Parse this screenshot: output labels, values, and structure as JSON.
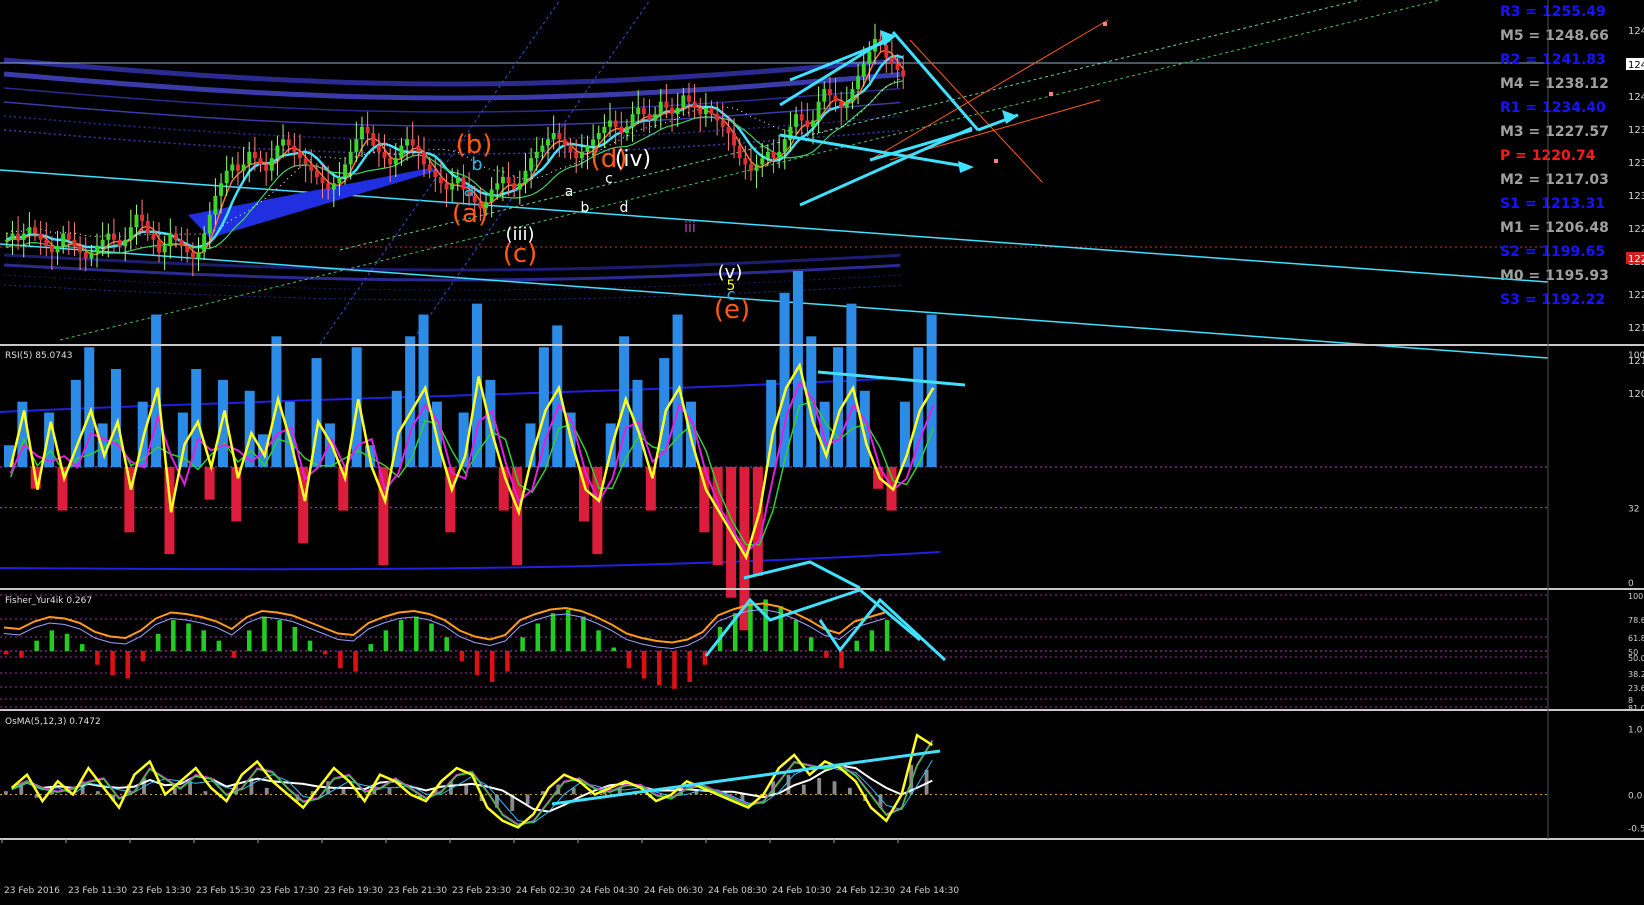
{
  "colors": {
    "background": "#000000",
    "separator": "#c8c8c8",
    "axis_text": "#d0d0d0",
    "cyan": "#40e0ff",
    "candle_up": "#3fd62a",
    "candle_down": "#e03030",
    "pivot_blue": "#1414ff",
    "pivot_gray": "#a0a0a0",
    "pivot_red": "#ff1a1a",
    "rsi_line": "#ffff20",
    "hist_pos": "#2b8be6",
    "hist_neg": "#dc1e3c",
    "fisher_pos": "#22cc22",
    "fisher_neg": "#dd1111",
    "fisher_line": "#ff9a1a",
    "wave_orange": "#ff5a14",
    "wave_white": "#ffffff",
    "wave_cyan": "#30b0e0"
  },
  "pivots": [
    {
      "label": "R3 = 1255.49",
      "color": "#1414ff"
    },
    {
      "label": "M5 = 1248.66",
      "color": "#a0a0a0"
    },
    {
      "label": "R2 = 1241.83",
      "color": "#1414ff"
    },
    {
      "label": "M4 = 1238.12",
      "color": "#a0a0a0"
    },
    {
      "label": "R1 = 1234.40",
      "color": "#1414ff"
    },
    {
      "label": "M3 = 1227.57",
      "color": "#a0a0a0"
    },
    {
      "label": "P  = 1220.74",
      "color": "#ff1a1a"
    },
    {
      "label": "M2 = 1217.03",
      "color": "#a0a0a0"
    },
    {
      "label": "S1 = 1213.31",
      "color": "#1414ff"
    },
    {
      "label": "M1 = 1206.48",
      "color": "#a0a0a0"
    },
    {
      "label": "S2 = 1199.65",
      "color": "#1414ff"
    },
    {
      "label": "M0 = 1195.93",
      "color": "#a0a0a0"
    },
    {
      "label": "S3 = 1192.22",
      "color": "#1414ff"
    }
  ],
  "wave_labels": [
    {
      "text": "(b)",
      "color": "#ff5a14"
    },
    {
      "text": "b",
      "color": "#30b0e0"
    },
    {
      "text": "a",
      "color": "#30b0e0"
    },
    {
      "text": "(a)",
      "color": "#ff5a14"
    },
    {
      "text": "(iii)",
      "color": "#ffffff"
    },
    {
      "text": "(c)",
      "color": "#ff5a14"
    },
    {
      "text": "(d)",
      "color": "#ff5a14"
    },
    {
      "text": "(iv)",
      "color": "#ffffff"
    },
    {
      "text": "a",
      "color": "#ffffff"
    },
    {
      "text": "b",
      "color": "#ffffff"
    },
    {
      "text": "c",
      "color": "#ffffff"
    },
    {
      "text": "d",
      "color": "#ffffff"
    },
    {
      "text": "iii",
      "color": "#c040c0"
    },
    {
      "text": "(v)",
      "color": "#ffffff"
    },
    {
      "text": "5",
      "color": "#ffff20"
    },
    {
      "text": "c",
      "color": "#30b0e0"
    },
    {
      "text": "(e)",
      "color": "#ff5a14"
    }
  ],
  "time_labels": [
    "23 Feb 2016",
    "23 Feb 11:30",
    "23 Feb 13:30",
    "23 Feb 15:30",
    "23 Feb 17:30",
    "23 Feb 19:30",
    "23 Feb 21:30",
    "23 Feb 23:30",
    "24 Feb 02:30",
    "24 Feb 04:30",
    "24 Feb 06:30",
    "24 Feb 08:30",
    "24 Feb 10:30",
    "24 Feb 12:30",
    "24 Feb 14:30"
  ],
  "chart_data": [
    {
      "type": "candlestick",
      "panel": "price",
      "y_tick_labels": [
        "124",
        "124",
        "124",
        "123",
        "123",
        "123",
        "122",
        "122",
        "122",
        "121",
        "121",
        "120"
      ],
      "price_marker_top": "124",
      "price_marker_mid": "122",
      "close": [
        1215,
        1216,
        1215,
        1216,
        1217,
        1216,
        1215,
        1214,
        1213,
        1214,
        1216,
        1215,
        1214,
        1213,
        1212,
        1213,
        1214,
        1215,
        1216,
        1215,
        1214,
        1215,
        1217,
        1219,
        1218,
        1216,
        1215,
        1213,
        1214,
        1216,
        1215,
        1214,
        1213,
        1212,
        1213,
        1216,
        1219,
        1222,
        1224,
        1226,
        1227,
        1226,
        1227,
        1229,
        1228,
        1227,
        1226,
        1228,
        1230,
        1231,
        1230,
        1229,
        1228,
        1227,
        1226,
        1225,
        1224,
        1223,
        1224,
        1225,
        1227,
        1229,
        1231,
        1233,
        1232,
        1230,
        1229,
        1228,
        1227,
        1228,
        1230,
        1231,
        1230,
        1229,
        1227,
        1226,
        1225,
        1224,
        1223,
        1224,
        1225,
        1223,
        1222,
        1221,
        1220,
        1221,
        1223,
        1224,
        1225,
        1224,
        1223,
        1224,
        1226,
        1228,
        1229,
        1230,
        1231,
        1232,
        1231,
        1230,
        1229,
        1228,
        1229,
        1230,
        1231,
        1232,
        1233,
        1234,
        1233,
        1232,
        1233,
        1235,
        1236,
        1235,
        1234,
        1235,
        1237,
        1236,
        1235,
        1236,
        1238,
        1237,
        1236,
        1235,
        1236,
        1235,
        1234,
        1233,
        1232,
        1230,
        1228,
        1227,
        1226,
        1227,
        1228,
        1229,
        1228,
        1229,
        1231,
        1233,
        1235,
        1234,
        1233,
        1234,
        1237,
        1239,
        1238,
        1237,
        1236,
        1237,
        1239,
        1241,
        1243,
        1245,
        1247,
        1246,
        1244,
        1243,
        1242,
        1241
      ]
    },
    {
      "type": "bar",
      "panel": "rsi",
      "title": "RSI(5) 85.0743",
      "y_tick_labels": [
        "100",
        "32",
        "0"
      ],
      "ylim": [
        0,
        100
      ],
      "rsi": [
        50,
        75,
        40,
        70,
        45,
        60,
        75,
        55,
        70,
        40,
        65,
        85,
        30,
        60,
        70,
        50,
        75,
        45,
        65,
        55,
        80,
        60,
        35,
        70,
        60,
        45,
        80,
        50,
        35,
        65,
        75,
        85,
        60,
        40,
        55,
        90,
        65,
        45,
        30,
        55,
        75,
        85,
        60,
        40,
        35,
        60,
        80,
        65,
        45,
        75,
        85,
        60,
        40,
        30,
        20,
        10,
        30,
        65,
        85,
        95,
        70,
        55,
        75,
        85,
        60,
        45,
        40,
        55,
        75,
        85
      ],
      "histogram": [
        10,
        30,
        -10,
        25,
        -20,
        40,
        55,
        20,
        45,
        -30,
        30,
        70,
        -40,
        25,
        45,
        -15,
        40,
        -25,
        35,
        15,
        60,
        30,
        -35,
        50,
        20,
        -20,
        55,
        10,
        -45,
        35,
        60,
        70,
        30,
        -30,
        25,
        75,
        40,
        -20,
        -45,
        20,
        55,
        65,
        25,
        -25,
        -40,
        20,
        60,
        40,
        -20,
        50,
        70,
        30,
        -30,
        -45,
        -60,
        -75,
        -50,
        40,
        80,
        90,
        60,
        30,
        55,
        75,
        35,
        -10,
        -20,
        30,
        55,
        70
      ]
    },
    {
      "type": "bar",
      "panel": "fisher",
      "title": "Fisher_Yur4ik 0.267",
      "y_tick_labels": [
        "100",
        "78.6",
        "61.8",
        "50",
        "50.0",
        "38.2",
        "23.6",
        "8",
        "81.0"
      ],
      "values": [
        -5,
        -10,
        15,
        30,
        25,
        10,
        -20,
        -35,
        -40,
        -15,
        25,
        45,
        40,
        30,
        15,
        -10,
        30,
        50,
        45,
        35,
        15,
        -5,
        -25,
        -30,
        10,
        30,
        45,
        50,
        40,
        20,
        -15,
        -35,
        -45,
        -30,
        20,
        40,
        55,
        60,
        50,
        30,
        5,
        -25,
        -40,
        -50,
        -55,
        -45,
        -20,
        35,
        55,
        70,
        75,
        65,
        45,
        20,
        -10,
        -25,
        15,
        30,
        45
      ]
    },
    {
      "type": "line",
      "panel": "osma",
      "title": "OsMA(5,12,3) 0.7472",
      "y_tick_labels": [
        "1.0",
        "0.0",
        "-0.5"
      ],
      "ylim": [
        -0.6,
        1.1
      ],
      "values": [
        0.1,
        0.3,
        -0.1,
        0.2,
        0.0,
        0.4,
        0.1,
        -0.2,
        0.3,
        0.5,
        0.0,
        0.2,
        0.4,
        0.1,
        -0.1,
        0.3,
        0.5,
        0.2,
        0.0,
        -0.2,
        0.1,
        0.4,
        0.2,
        -0.1,
        0.3,
        0.2,
        0.0,
        -0.1,
        0.2,
        0.4,
        0.3,
        -0.2,
        -0.4,
        -0.5,
        -0.3,
        0.1,
        0.3,
        0.2,
        0.0,
        0.1,
        0.2,
        0.1,
        -0.1,
        0.0,
        0.2,
        0.1,
        0.0,
        -0.1,
        -0.2,
        0.0,
        0.4,
        0.6,
        0.3,
        0.5,
        0.4,
        0.2,
        -0.2,
        -0.4,
        0.0,
        0.9,
        0.75
      ]
    }
  ]
}
